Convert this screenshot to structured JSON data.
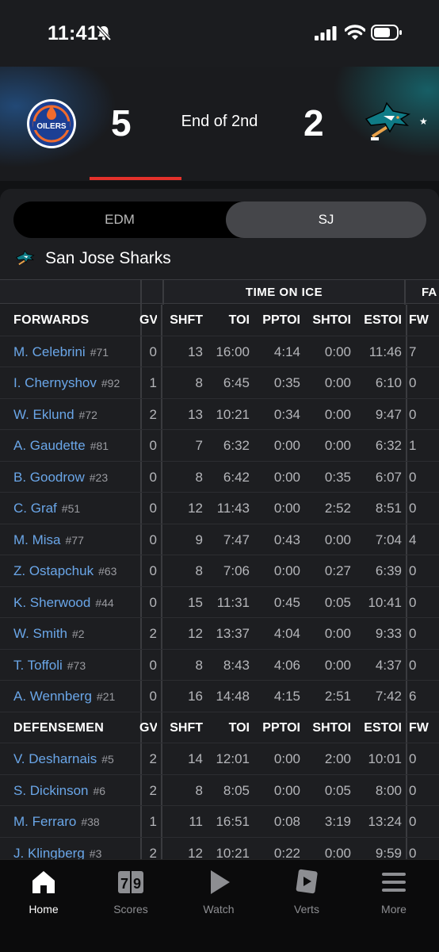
{
  "status_bar": {
    "time": "11:41"
  },
  "scoreboard": {
    "home_team": "EDM",
    "home_score": "5",
    "period": "End of 2nd",
    "away_score": "2",
    "away_team": "SJ",
    "favorite_marker": "★",
    "home_logo_text": "OILERS"
  },
  "team_toggle": {
    "options": [
      "EDM",
      "SJ"
    ],
    "selected": "SJ"
  },
  "team_name": "San Jose Sharks",
  "table": {
    "group_headers": {
      "time_on_ice": "TIME ON ICE",
      "faceoffs": "FA"
    },
    "columns": [
      "GV",
      "SHFT",
      "TOI",
      "PPTOI",
      "SHTOI",
      "ESTOI",
      "FW"
    ],
    "sections": [
      {
        "title": "FORWARDS",
        "players": [
          {
            "name": "M. Celebrini",
            "number": "#71",
            "gv": "0",
            "shft": "13",
            "toi": "16:00",
            "pptoi": "4:14",
            "shtoi": "0:00",
            "estoi": "11:46",
            "fw": "7"
          },
          {
            "name": "I. Chernyshov",
            "number": "#92",
            "gv": "1",
            "shft": "8",
            "toi": "6:45",
            "pptoi": "0:35",
            "shtoi": "0:00",
            "estoi": "6:10",
            "fw": "0"
          },
          {
            "name": "W. Eklund",
            "number": "#72",
            "gv": "2",
            "shft": "13",
            "toi": "10:21",
            "pptoi": "0:34",
            "shtoi": "0:00",
            "estoi": "9:47",
            "fw": "0"
          },
          {
            "name": "A. Gaudette",
            "number": "#81",
            "gv": "0",
            "shft": "7",
            "toi": "6:32",
            "pptoi": "0:00",
            "shtoi": "0:00",
            "estoi": "6:32",
            "fw": "1"
          },
          {
            "name": "B. Goodrow",
            "number": "#23",
            "gv": "0",
            "shft": "8",
            "toi": "6:42",
            "pptoi": "0:00",
            "shtoi": "0:35",
            "estoi": "6:07",
            "fw": "0"
          },
          {
            "name": "C. Graf",
            "number": "#51",
            "gv": "0",
            "shft": "12",
            "toi": "11:43",
            "pptoi": "0:00",
            "shtoi": "2:52",
            "estoi": "8:51",
            "fw": "0"
          },
          {
            "name": "M. Misa",
            "number": "#77",
            "gv": "0",
            "shft": "9",
            "toi": "7:47",
            "pptoi": "0:43",
            "shtoi": "0:00",
            "estoi": "7:04",
            "fw": "4"
          },
          {
            "name": "Z. Ostapchuk",
            "number": "#63",
            "gv": "0",
            "shft": "8",
            "toi": "7:06",
            "pptoi": "0:00",
            "shtoi": "0:27",
            "estoi": "6:39",
            "fw": "0"
          },
          {
            "name": "K. Sherwood",
            "number": "#44",
            "gv": "0",
            "shft": "15",
            "toi": "11:31",
            "pptoi": "0:45",
            "shtoi": "0:05",
            "estoi": "10:41",
            "fw": "0"
          },
          {
            "name": "W. Smith",
            "number": "#2",
            "gv": "2",
            "shft": "12",
            "toi": "13:37",
            "pptoi": "4:04",
            "shtoi": "0:00",
            "estoi": "9:33",
            "fw": "0"
          },
          {
            "name": "T. Toffoli",
            "number": "#73",
            "gv": "0",
            "shft": "8",
            "toi": "8:43",
            "pptoi": "4:06",
            "shtoi": "0:00",
            "estoi": "4:37",
            "fw": "0"
          },
          {
            "name": "A. Wennberg",
            "number": "#21",
            "gv": "0",
            "shft": "16",
            "toi": "14:48",
            "pptoi": "4:15",
            "shtoi": "2:51",
            "estoi": "7:42",
            "fw": "6"
          }
        ]
      },
      {
        "title": "DEFENSEMEN",
        "players": [
          {
            "name": "V. Desharnais",
            "number": "#5",
            "gv": "2",
            "shft": "14",
            "toi": "12:01",
            "pptoi": "0:00",
            "shtoi": "2:00",
            "estoi": "10:01",
            "fw": "0"
          },
          {
            "name": "S. Dickinson",
            "number": "#6",
            "gv": "2",
            "shft": "8",
            "toi": "8:05",
            "pptoi": "0:00",
            "shtoi": "0:05",
            "estoi": "8:00",
            "fw": "0"
          },
          {
            "name": "M. Ferraro",
            "number": "#38",
            "gv": "1",
            "shft": "11",
            "toi": "16:51",
            "pptoi": "0:08",
            "shtoi": "3:19",
            "estoi": "13:24",
            "fw": "0"
          },
          {
            "name": "J. Klingberg",
            "number": "#3",
            "gv": "2",
            "shft": "12",
            "toi": "10:21",
            "pptoi": "0:22",
            "shtoi": "0:00",
            "estoi": "9:59",
            "fw": "0"
          }
        ]
      }
    ]
  },
  "tab_bar": {
    "tabs": [
      {
        "label": "Home",
        "icon": "home-icon",
        "active": true
      },
      {
        "label": "Scores",
        "icon": "scores-icon",
        "active": false
      },
      {
        "label": "Watch",
        "icon": "play-icon",
        "active": false
      },
      {
        "label": "Verts",
        "icon": "verts-icon",
        "active": false
      },
      {
        "label": "More",
        "icon": "menu-icon",
        "active": false
      }
    ]
  },
  "colors": {
    "accent_red": "#e4312b",
    "player_link": "#6aa6e8",
    "oilers_blue": "#1c3f94",
    "oilers_orange": "#f26b2d"
  }
}
